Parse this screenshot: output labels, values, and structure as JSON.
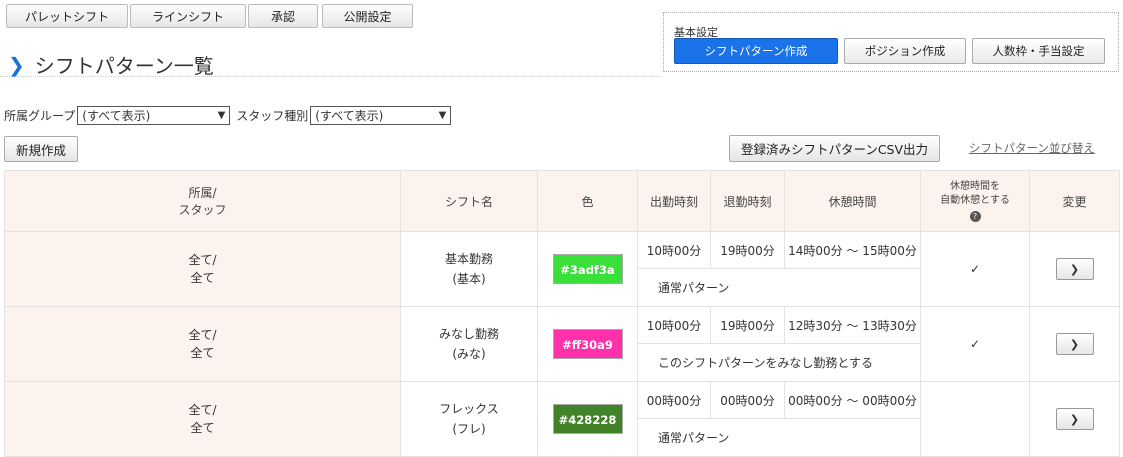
{
  "top_tabs": [
    "パレットシフト",
    "ラインシフト",
    "承認",
    "公開設定"
  ],
  "page_title": "シフトパターン一覧",
  "settings": {
    "label": "基本設定",
    "buttons": [
      "シフトパターン作成",
      "ポジション作成",
      "人数枠・手当設定"
    ]
  },
  "filters": {
    "group_label": "所属グループ",
    "group_value": "(すべて表示)",
    "staff_label": "スタッフ種別",
    "staff_value": "(すべて表示)"
  },
  "new_button": "新規作成",
  "csv_button": "登録済みシフトパターンCSV出力",
  "sort_link": "シフトパターン並び替え",
  "headers": {
    "staff_line1": "所属/",
    "staff_line2": "スタッフ",
    "name": "シフト名",
    "color": "色",
    "start": "出勤時刻",
    "end": "退勤時刻",
    "break": "休憩時間",
    "auto_line1": "休憩時間を",
    "auto_line2": "自動休憩とする",
    "change": "変更"
  },
  "rows": [
    {
      "staff1": "全て/",
      "staff2": "全て",
      "name1": "基本勤務",
      "name2": "(基本)",
      "color": "#3adf3a",
      "start": "10時00分",
      "end": "19時00分",
      "break": "14時00分 〜 15時00分",
      "note": "通常パターン",
      "auto": "✓"
    },
    {
      "staff1": "全て/",
      "staff2": "全て",
      "name1": "みなし勤務",
      "name2": "(みな)",
      "color": "#ff30a9",
      "start": "10時00分",
      "end": "19時00分",
      "break": "12時30分 〜 13時30分",
      "note": "このシフトパターンをみなし勤務とする",
      "auto": "✓"
    },
    {
      "staff1": "全て/",
      "staff2": "全て",
      "name1": "フレックス",
      "name2": "(フレ)",
      "color": "#428228",
      "start": "00時00分",
      "end": "00時00分",
      "break": "00時00分 〜 00時00分",
      "note": "通常パターン",
      "auto": ""
    }
  ],
  "icons": {
    "title": "chevron-right-icon",
    "row_action": "chevron-right-icon",
    "help": "question-circle-icon"
  },
  "accent_color": "#1a73e8"
}
